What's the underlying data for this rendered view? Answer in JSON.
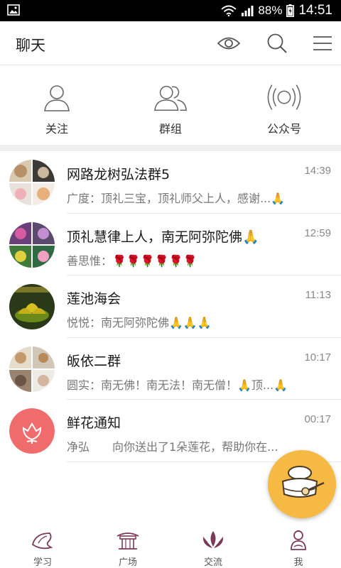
{
  "status_bar": {
    "battery": "88%",
    "time": "14:51"
  },
  "header": {
    "title": "聊天"
  },
  "quick_links": [
    {
      "label": "关注"
    },
    {
      "label": "群组"
    },
    {
      "label": "公众号"
    }
  ],
  "chats": [
    {
      "name": "网路龙树弘法群5",
      "time": "14:39",
      "preview": "广度：顶礼三宝，顶礼师父上人，感谢...🙏"
    },
    {
      "name": "顶礼慧律上人，南无阿弥陀佛🙏",
      "time": "12:59",
      "preview": "善思惟：🌹🌹🌹🌹🌹🌹"
    },
    {
      "name": "莲池海会",
      "time": "11:13",
      "preview": "悦悦：南无阿弥陀佛🙏🙏🙏"
    },
    {
      "name": "皈依二群",
      "time": "10:17",
      "preview": "圆实：南无佛！南无法！南无僧！🙏顶...🙏"
    },
    {
      "name": "鲜花通知",
      "time": "00:17",
      "preview": "净弘　　向你送出了1朵莲花，帮助你在..."
    }
  ],
  "bottom_nav": [
    {
      "label": "学习"
    },
    {
      "label": "广场"
    },
    {
      "label": "交流"
    },
    {
      "label": "我"
    }
  ],
  "colors": {
    "accent": "#8a3a5a",
    "fab": "#f5b944",
    "flower_avatar": "#f06b6b"
  }
}
